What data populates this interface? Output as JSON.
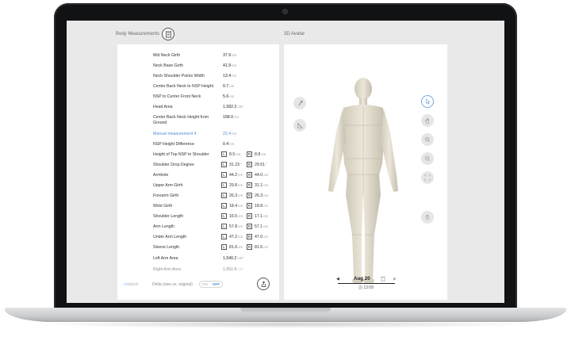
{
  "left_panel": {
    "title": "Body Measurements",
    "measurements": [
      {
        "label": "Mid Neck Girth",
        "value": "37.9",
        "unit": "cm"
      },
      {
        "label": "Neck Base Girth",
        "value": "41.9",
        "unit": "cm"
      },
      {
        "label": "Neck-Shoulder Points Width",
        "value": "13.4",
        "unit": "cm"
      },
      {
        "label": "Center Back Neck to NSP Height",
        "value": "0.7",
        "unit": "cm"
      },
      {
        "label": "NSP to Center Front Neck",
        "value": "5.6",
        "unit": "cm"
      },
      {
        "label": "Head Area",
        "value": "1,582.2",
        "unit": "cm²"
      },
      {
        "label": "Center Back Neck Height from Ground",
        "value": "158.0",
        "unit": "cm"
      },
      {
        "label": "Manual measurement 4",
        "value": "22.4",
        "unit": "cm"
      },
      {
        "label": "NSP Height Difference",
        "value": "0.4",
        "unit": "cm"
      },
      {
        "label": "Height of Top NSP to Shoulder",
        "l": "8.5",
        "r": "8.8",
        "unit": "cm"
      },
      {
        "label": "Shoulder Drop Degree",
        "l": "31.23",
        "r": "29.51",
        "unit": "°"
      },
      {
        "label": "Armhole",
        "l": "44.2",
        "r": "44.0",
        "unit": "cm"
      },
      {
        "label": "Upper Arm Girth",
        "l": "29.8",
        "r": "31.1",
        "unit": "cm"
      },
      {
        "label": "Forearm Girth",
        "l": "26.3",
        "r": "26.3",
        "unit": "cm"
      },
      {
        "label": "Wrist Girth",
        "l": "18.4",
        "r": "18.8",
        "unit": "cm"
      },
      {
        "label": "Shoulder Length",
        "l": "16.5",
        "r": "17.1",
        "unit": "cm"
      },
      {
        "label": "Arm Length",
        "l": "57.8",
        "r": "57.1",
        "unit": "cm"
      },
      {
        "label": "Under Arm Length",
        "l": "47.2",
        "r": "47.0",
        "unit": "cm"
      },
      {
        "label": "Sleeve Length",
        "l": "81.6",
        "r": "81.6",
        "unit": "cm"
      },
      {
        "label": "Left Arm Area",
        "value": "1,540.2",
        "unit": "cm²"
      },
      {
        "label": "Right Arm Area",
        "value": "1,551.9",
        "unit": "cm²"
      }
    ],
    "side_left": "L",
    "side_right": "R",
    "units_cm": "cm",
    "units_sep": "|",
    "units_inch": "inch",
    "delta_label": "Delta (new vs. original)",
    "toggle_on": "ON",
    "toggle_off": "OFF"
  },
  "right_panel": {
    "title": "3D Avatar",
    "date": "Aug 20",
    "time": "13:09",
    "prev_arrow": "◀",
    "next_arrow": "▶",
    "accent_color": "#7aa9dc"
  }
}
